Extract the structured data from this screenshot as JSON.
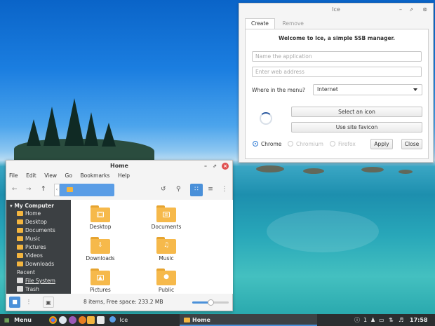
{
  "ice": {
    "title": "Ice",
    "tabs": [
      "Create",
      "Remove"
    ],
    "welcome": "Welcome to Ice, a simple SSB manager.",
    "name_placeholder": "Name the application",
    "url_placeholder": "Enter web address",
    "menu_label": "Where in the menu?",
    "menu_value": "Internet",
    "select_icon": "Select an icon",
    "use_favicon": "Use site favicon",
    "browsers": [
      "Chrome",
      "Chromium",
      "Firefox"
    ],
    "selected_browser": "Chrome",
    "apply": "Apply",
    "close": "Close"
  },
  "fm": {
    "title": "Home",
    "menu": [
      "File",
      "Edit",
      "View",
      "Go",
      "Bookmarks",
      "Help"
    ],
    "sidebar_header": "My Computer",
    "sidebar_items": [
      "Home",
      "Desktop",
      "Documents",
      "Music",
      "Pictures",
      "Videos",
      "Downloads",
      "Recent",
      "File System",
      "Trash"
    ],
    "files": [
      "Desktop",
      "Documents",
      "Downloads",
      "Music",
      "Pictures",
      "Public"
    ],
    "status": "8 items, Free space: 233.2 MB",
    "zoom_level": 0.5
  },
  "taskbar": {
    "menu": "Menu",
    "ice_task": "Ice",
    "home_task": "Home",
    "workspace": "1",
    "clock": "17:58"
  },
  "colors": {
    "accent": "#4a90d9",
    "folder": "#f6b94b",
    "sidebar": "#3c4043",
    "taskbar": "#2b2e30",
    "close": "#e05050"
  }
}
